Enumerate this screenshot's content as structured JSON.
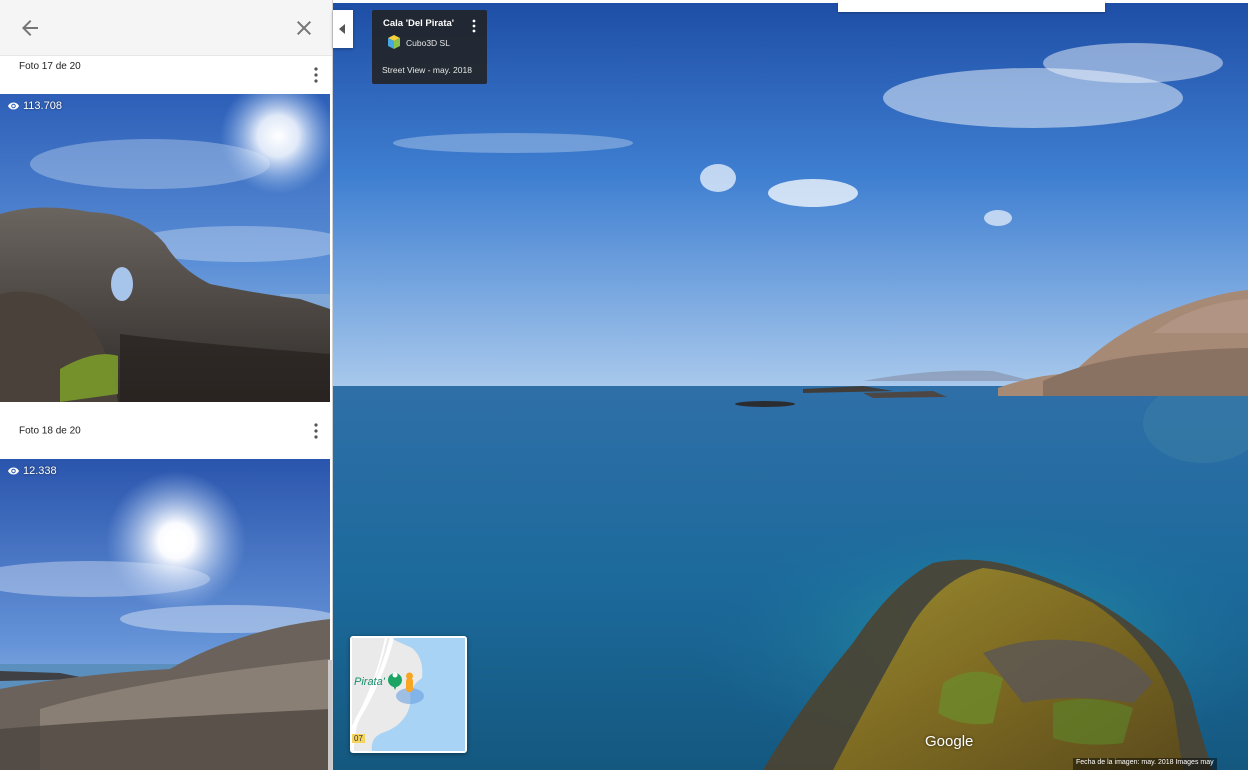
{
  "panel": {
    "back_icon": "arrow-left-icon",
    "close_icon": "close-icon",
    "photos": [
      {
        "caption": "Foto 17 de 20",
        "views": null
      },
      {
        "caption": "Foto 18 de 20",
        "views": "113.708"
      },
      {
        "caption": null,
        "views": "12.338"
      }
    ]
  },
  "info_card": {
    "title": "Cala 'Del Pirata'",
    "author": "Cubo3D SL",
    "date": "Street View - may. 2018",
    "menu_icon": "more-vert-icon"
  },
  "minimap": {
    "place_label": "Pirata'",
    "road_label": "07"
  },
  "viewer": {
    "logo": "Google",
    "attribution": "Fecha de la imagen: may. 2018    Images may"
  },
  "colors": {
    "sky": "#3f7fd1",
    "sea": "#1c6a9c",
    "moss": "#8a7a28"
  }
}
